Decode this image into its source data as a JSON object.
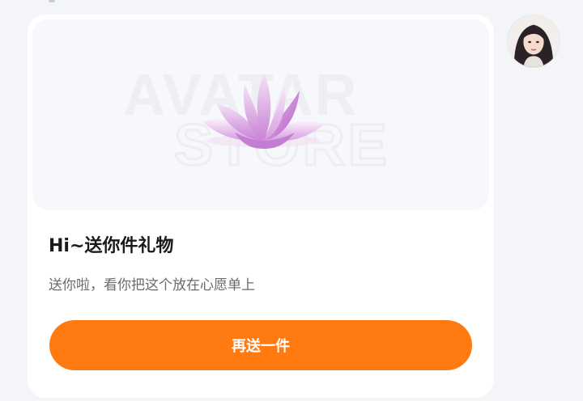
{
  "gift_card": {
    "image": {
      "watermark_line1": "AVATAR",
      "watermark_line2": "STORE",
      "icon": "lotus-flower-icon"
    },
    "title": "Hi~送你件礼物",
    "subtitle": "送你啦，看你把这个放在心愿单上",
    "button_label": "再送一件"
  },
  "avatar": {
    "icon": "user-avatar-portrait"
  },
  "colors": {
    "background": "#f3f5f8",
    "card": "#ffffff",
    "button": "#ff7a10",
    "title": "#1a1a1a",
    "subtitle": "#6b6b6b",
    "lotus": "#d9a3e3"
  }
}
